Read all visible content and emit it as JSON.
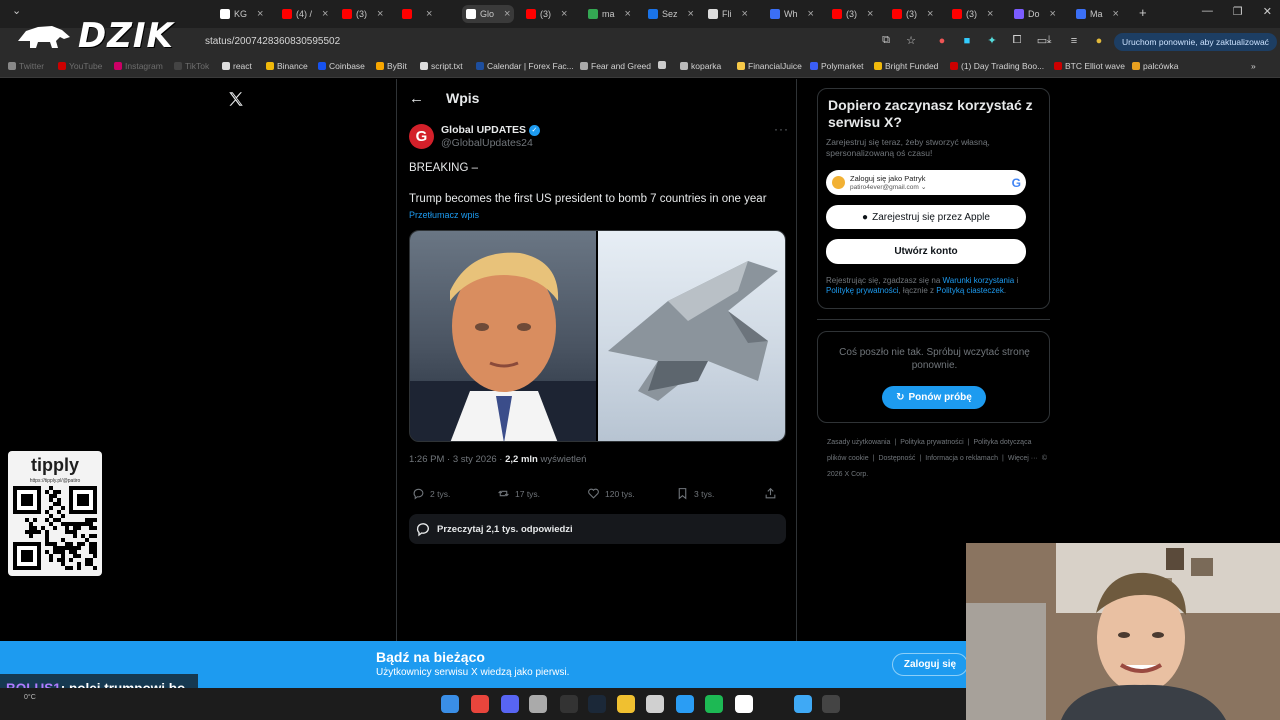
{
  "browser": {
    "tabs": [
      {
        "label": "KG",
        "favicon_color": "#ffffff"
      },
      {
        "label": "(4) /",
        "favicon_color": "#ff0000"
      },
      {
        "label": "(3)",
        "favicon_color": "#ff0000"
      },
      {
        "label": "",
        "favicon_color": "#ff0000"
      },
      {
        "label": "Glo",
        "favicon_color": "#ffffff"
      },
      {
        "label": "(3)",
        "favicon_color": "#ff0000"
      },
      {
        "label": "ma",
        "favicon_color": "#34a853"
      },
      {
        "label": "Sez",
        "favicon_color": "#1a73e8"
      },
      {
        "label": "Fli",
        "favicon_color": "#dddddd"
      },
      {
        "label": "Wh",
        "favicon_color": "#3b6ff5"
      },
      {
        "label": "(3)",
        "favicon_color": "#ff0000"
      },
      {
        "label": "(3)",
        "favicon_color": "#ff0000"
      },
      {
        "label": "(3)",
        "favicon_color": "#ff0000"
      },
      {
        "label": "Do",
        "favicon_color": "#7b5cff"
      },
      {
        "label": "Ma",
        "favicon_color": "#3b6ff5"
      }
    ],
    "url": "status/2007428360830595502",
    "update_button": "Uruchom ponownie, aby zaktualizować",
    "bookmarks": [
      {
        "label": "Twitter",
        "dim": true
      },
      {
        "label": "YouTube",
        "dim": true
      },
      {
        "label": "Instagram",
        "dim": true
      },
      {
        "label": "TikTok",
        "dim": true
      },
      {
        "label": "react",
        "dim": false
      },
      {
        "label": "Binance",
        "dim": false
      },
      {
        "label": "Coinbase",
        "dim": false
      },
      {
        "label": "ByBit",
        "dim": false
      },
      {
        "label": "script.txt",
        "dim": false
      },
      {
        "label": "Calendar | Forex Fac...",
        "dim": false
      },
      {
        "label": "Fear and Greed",
        "dim": false
      },
      {
        "label": "",
        "dim": false
      },
      {
        "label": "koparka",
        "dim": false
      },
      {
        "label": "FinancialJuice",
        "dim": false
      },
      {
        "label": "Polymarket",
        "dim": false
      },
      {
        "label": "Bright Funded",
        "dim": false
      },
      {
        "label": "(1) Day Trading Boo...",
        "dim": false
      },
      {
        "label": "BTC Elliot wave",
        "dim": false
      },
      {
        "label": "palcówka",
        "dim": false
      }
    ]
  },
  "overlay": {
    "logo_text": "DZIK",
    "tipply_logo": "tipply",
    "tipply_url": "https://tipply.pl/@patiro"
  },
  "post": {
    "header": "Wpis",
    "author_name": "Global UPDATES",
    "author_handle": "@GlobalUpdates24",
    "avatar_letter": "G",
    "breaking": "BREAKING –",
    "body": "Trump becomes the first US president to bomb 7 countries in one year",
    "translate": "Przetłumacz wpis",
    "time": "1:26 PM · 3 sty 2026 · ",
    "views_count": "2,2 mln",
    "views_label": " wyświetleń",
    "actions": {
      "replies": "2 tys.",
      "reposts": "17 tys.",
      "likes": "120 tys.",
      "bookmarks": "3 tys."
    },
    "read_replies": "Przeczytaj 2,1 tys. odpowiedzi"
  },
  "sidebar": {
    "signup_title": "Dopiero zaczynasz korzystać z serwisu X?",
    "signup_sub": "Zarejestruj się teraz, żeby stworzyć własną, spersonalizowaną oś czasu!",
    "google_name": "Zaloguj się jako Patryk",
    "google_email": "patiro4ever@gmail.com",
    "apple_button": "Zarejestruj się przez Apple",
    "create_button": "Utwórz konto",
    "terms_prefix": "Rejestrując się, zgadzasz się na ",
    "terms_link1": "Warunki korzystania",
    "terms_mid1": " i ",
    "terms_link2": "Politykę prywatności",
    "terms_mid2": ", łącznie z ",
    "terms_link3": "Polityką ciasteczek",
    "terms_end": ".",
    "error_text": "Coś poszło nie tak. Spróbuj wczytać stronę ponownie.",
    "retry_button": "Ponów próbę",
    "footer_links": [
      "Zasady użytkowania",
      "|",
      "Polityka prywatności",
      "|",
      "Polityka dotycząca plików cookie",
      "|",
      "Dostępność",
      "|",
      "Informacja o reklamach",
      "|",
      "Więcej ···",
      "© 2026 X Corp."
    ]
  },
  "banner": {
    "title": "Bądź na bieżąco",
    "subtitle": "Użytkownicy serwisu X wiedzą jako pierwsi.",
    "login": "Zaloguj się"
  },
  "chat": {
    "user": "BOLUS1",
    "message": ": polej trumpowi bo ledwo stoi"
  },
  "taskbar": {
    "weather": "0°C"
  }
}
